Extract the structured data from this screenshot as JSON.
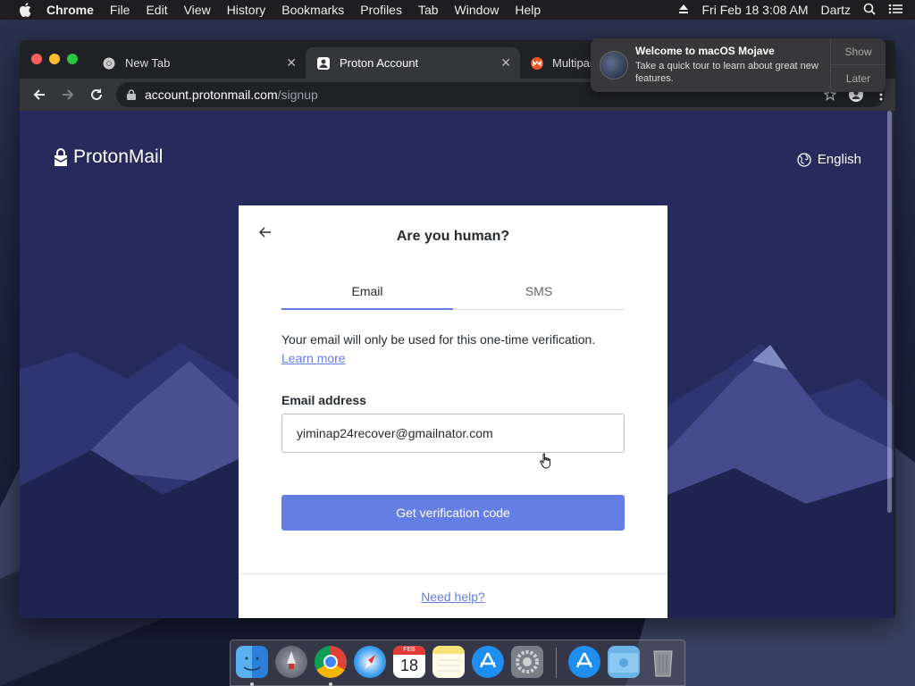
{
  "menubar": {
    "app_name": "Chrome",
    "menus": [
      "File",
      "Edit",
      "View",
      "History",
      "Bookmarks",
      "Profiles",
      "Tab",
      "Window",
      "Help"
    ],
    "datetime": "Fri Feb 18  3:08 AM",
    "user": "Dartz"
  },
  "browser": {
    "tabs": [
      {
        "title": "New Tab",
        "icon": "chrome-icon"
      },
      {
        "title": "Proton Account",
        "icon": "proton-account-icon"
      },
      {
        "title": "Multipas",
        "icon": "multipass-icon"
      }
    ],
    "url_host": "account.protonmail.com",
    "url_path": "/signup"
  },
  "notification": {
    "title": "Welcome to macOS Mojave",
    "body": "Take a quick tour to learn about great new features.",
    "show_label": "Show",
    "later_label": "Later"
  },
  "page": {
    "logo_text": "ProtonMail",
    "language": "English",
    "card": {
      "title": "Are you human?",
      "tabs": [
        "Email",
        "SMS"
      ],
      "selected_tab": "Email",
      "info_text": "Your email will only be used for this one-time verification.",
      "learn_more": "Learn more",
      "field_label": "Email address",
      "email_value": "yiminap24recover@gmailnator.com",
      "submit_label": "Get verification code",
      "help_link": "Need help?"
    },
    "colors": {
      "accent": "#657ee4",
      "page_bg": "#262a5c"
    }
  },
  "dock": {
    "apps": [
      "finder-icon",
      "launchpad-icon",
      "chrome-icon",
      "safari-icon",
      "calendar-icon",
      "notes-icon",
      "app-store-icon",
      "system-preferences-icon",
      "app-store-download-icon",
      "downloads-folder-icon",
      "trash-icon"
    ],
    "calendar_month": "FEB",
    "calendar_day": "18"
  }
}
